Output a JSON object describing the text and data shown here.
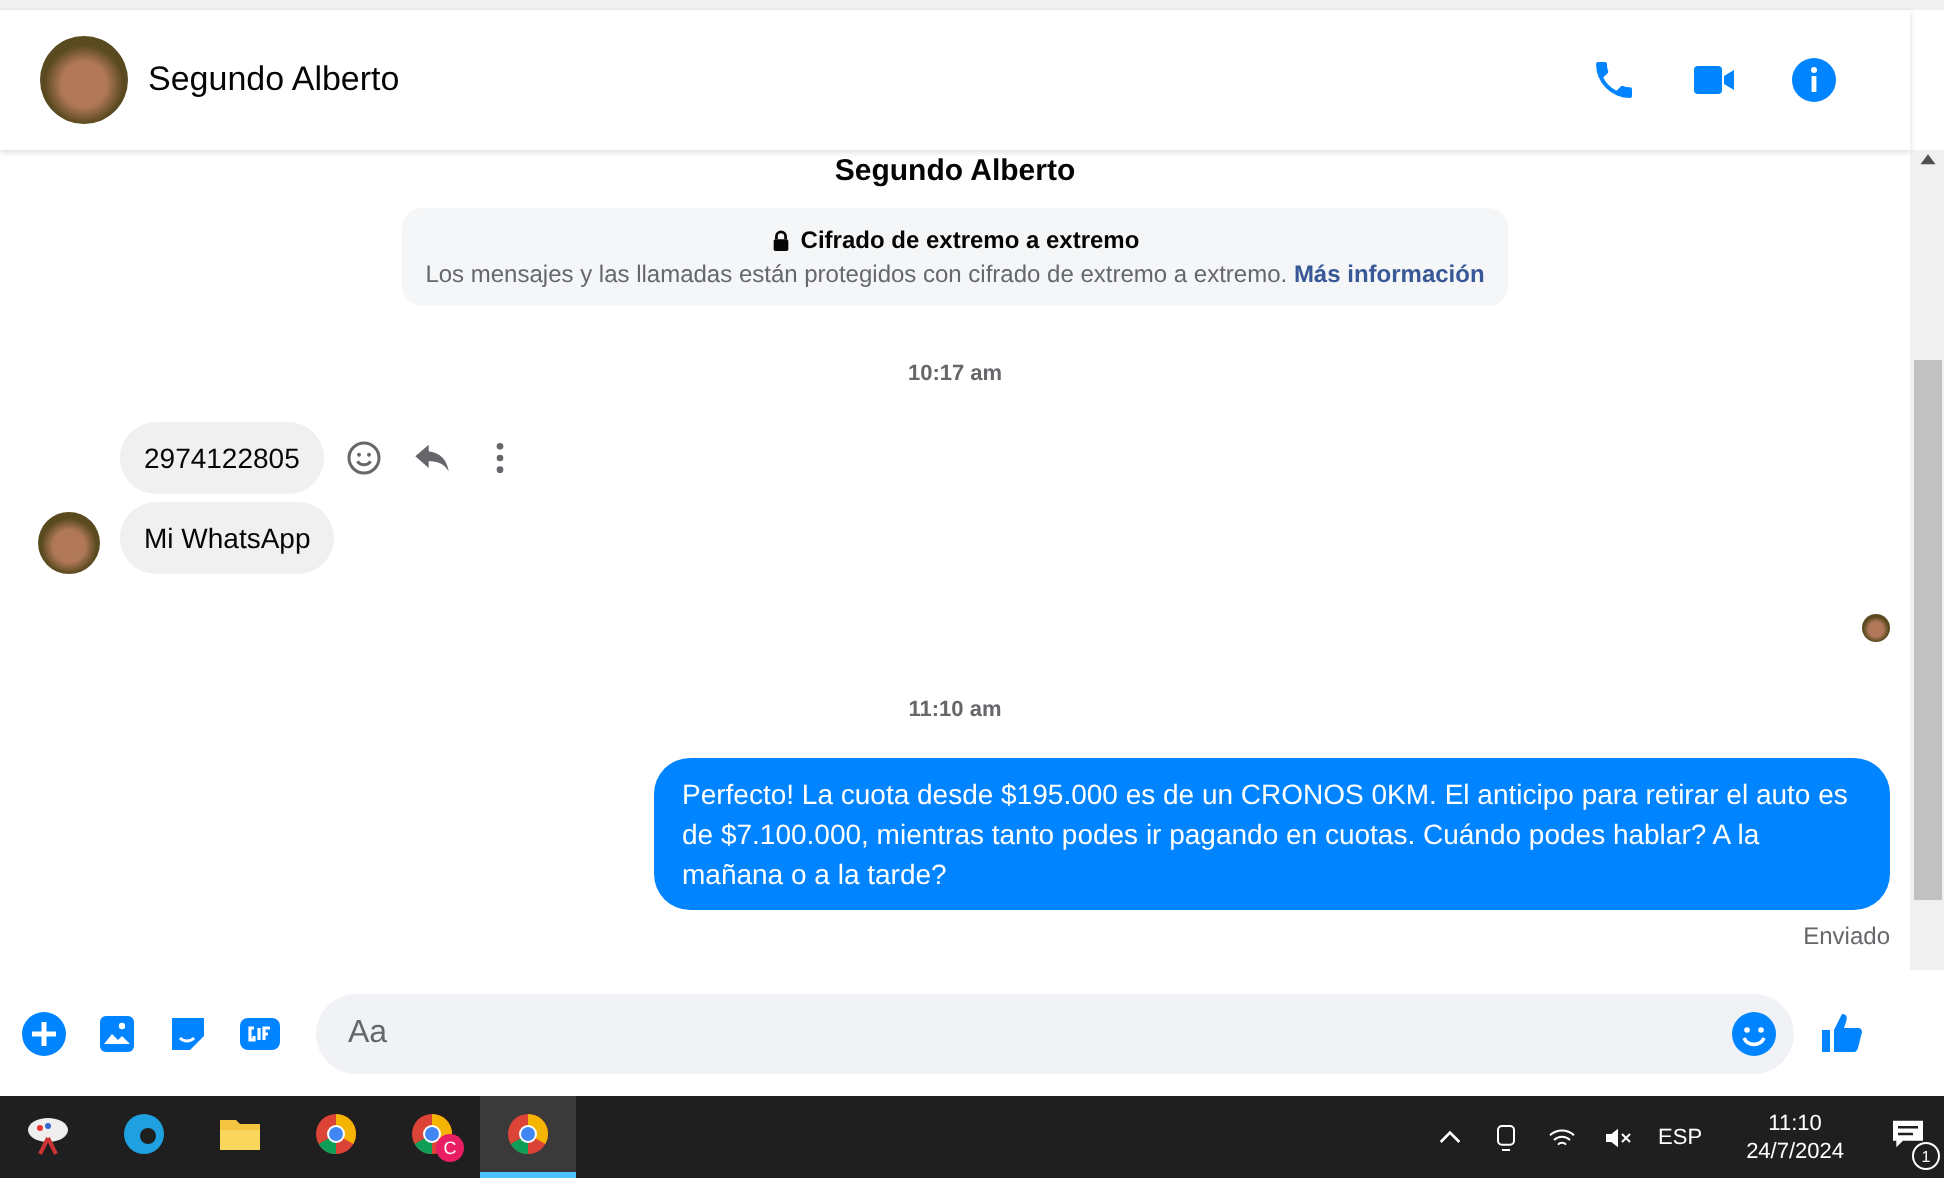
{
  "header": {
    "contact_name": "Segundo Alberto"
  },
  "chat": {
    "profile_name": "Segundo Alberto",
    "encryption": {
      "title": "Cifrado de extremo a extremo",
      "text": "Los mensajes y las llamadas están protegidos con cifrado de extremo a extremo.",
      "link": "Más información"
    },
    "groups": [
      {
        "time": "10:17 am",
        "messages": [
          {
            "text": "2974122805",
            "kind": "incoming",
            "hovered": true
          },
          {
            "text": "Mi WhatsApp",
            "kind": "incoming",
            "hovered": false
          }
        ],
        "read_receipt": true
      },
      {
        "time": "11:10 am",
        "messages": [
          {
            "text": "Perfecto! La cuota desde $195.000 es de un CRONOS 0KM. El anticipo para retirar el auto es de $7.100.000, mientras tanto podes ir pagando en cuotas. Cuándo podes hablar? A la mañana o a la tarde?",
            "kind": "outgoing",
            "hovered": false
          }
        ]
      }
    ],
    "status": "Enviado"
  },
  "composer": {
    "placeholder": "Aa"
  },
  "taskbar": {
    "apps": [
      {
        "kind": "paint",
        "selected": false
      },
      {
        "kind": "edge",
        "selected": false
      },
      {
        "kind": "folder",
        "selected": false
      },
      {
        "kind": "chrome",
        "selected": false
      },
      {
        "kind": "chrome-c",
        "selected": false,
        "badge": "C"
      },
      {
        "kind": "chrome-p",
        "selected": true
      }
    ],
    "language": "ESP",
    "time": "11:10",
    "date": "24/7/2024",
    "notifications": "1"
  }
}
